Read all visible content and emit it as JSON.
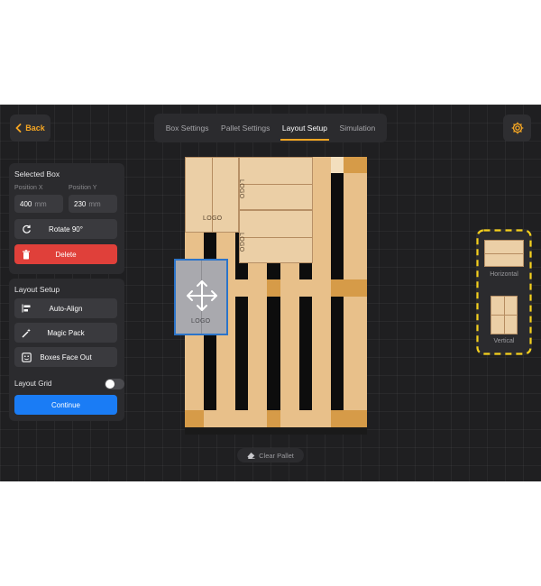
{
  "header": {
    "back_label": "Back",
    "tabs": [
      {
        "label": "Box Settings",
        "active": false
      },
      {
        "label": "Pallet Settings",
        "active": false
      },
      {
        "label": "Layout Setup",
        "active": true
      },
      {
        "label": "Simulation",
        "active": false
      }
    ],
    "settings_icon": "gear-icon"
  },
  "selected_box": {
    "title": "Selected Box",
    "position_x": {
      "label": "Position X",
      "value": "400",
      "unit": "mm"
    },
    "position_y": {
      "label": "Position Y",
      "value": "230",
      "unit": "mm"
    },
    "rotate_label": "Rotate 90°",
    "delete_label": "Delete"
  },
  "layout_setup": {
    "title": "Layout Setup",
    "auto_align_label": "Auto-Align",
    "magic_pack_label": "Magic Pack",
    "boxes_face_out_label": "Boxes Face Out",
    "layout_grid_label": "Layout Grid",
    "layout_grid_on": false,
    "continue_label": "Continue"
  },
  "canvas": {
    "box_logo": "LOGO",
    "clear_pallet_label": "Clear Pallet"
  },
  "orientation": {
    "horizontal_label": "Horizontal",
    "vertical_label": "Vertical"
  },
  "colors": {
    "accent": "#f5a623",
    "delete": "#e0403a",
    "primary": "#1a7cf5",
    "selection": "#2c74c9"
  }
}
